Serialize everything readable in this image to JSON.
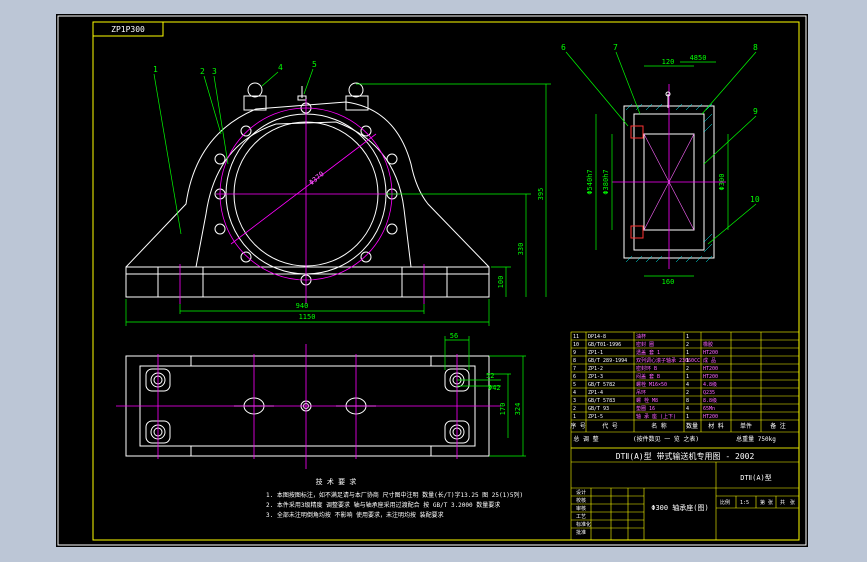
{
  "drawing": {
    "code_box": "ZP1P300",
    "colors": {
      "background": "#000000",
      "outline": "#ffffff",
      "frame": "#ffff00",
      "dimension": "#00ff00",
      "centerline": "#ff00ff",
      "hatch": "#00ffff",
      "text_magenta": "#ff66ff",
      "hidden": "#ff3333"
    }
  },
  "front_view": {
    "balloons": [
      "1",
      "2",
      "3",
      "4",
      "5"
    ],
    "dims": {
      "bore": "Φ370",
      "height_total": "395",
      "center_height": "330",
      "base_height": "100",
      "hole_span": "940",
      "overall_length": "1150"
    }
  },
  "section_view": {
    "balloons": [
      "6",
      "7",
      "8",
      "9",
      "10"
    ],
    "dims": {
      "top_a": "120",
      "top_b": "4850",
      "outer_d": "Φ540h7",
      "inner_d": "Φ380h7",
      "bore_d": "Φ300",
      "bottom": "160"
    }
  },
  "top_view": {
    "dims": {
      "slot": "56",
      "slot_b": "52",
      "hole": "Φ42",
      "width_a": "170",
      "width_b": "324"
    }
  },
  "notes": {
    "heading": "技 术 要 求",
    "lines": [
      "1. 本图按图标注，如不满足请与本厂协商 尺寸图中注明 数量(长/T)字13.25 图 25(1)5列)",
      "2. 本件采用3级精度 调整要求 轴与轴承座采用过渡配合 按 GB/T 3.2000 数量要求",
      "3. 全部未注明倒角均按 不影响 使用要求，未注明均按 装配要求"
    ]
  },
  "parts_table": {
    "rows": [
      [
        "11",
        "DP14-8",
        "油杯",
        "1",
        "",
        "",
        ""
      ],
      [
        "10",
        "GB/T01-1996",
        "密封 圈",
        "2",
        "橡胶",
        "",
        ""
      ],
      [
        "9",
        "ZP1-1",
        "透盖 套 1",
        "1",
        "HT200",
        "",
        ""
      ],
      [
        "8",
        "GB/T 289-1994",
        "双列调心滚子轴承 23060CC",
        "1",
        "成 品",
        "",
        ""
      ],
      [
        "7",
        "ZP1-2",
        "密封环 B",
        "2",
        "HT200",
        "",
        ""
      ],
      [
        "6",
        "ZP1-3",
        "闷盖 套 B",
        "1",
        "HT200",
        "",
        ""
      ],
      [
        "5",
        "GB/T 5782",
        "螺栓 M16×50",
        "4",
        "4.8级",
        "",
        ""
      ],
      [
        "4",
        "ZP1-4",
        "吊环",
        "2",
        "Q235",
        "",
        ""
      ],
      [
        "3",
        "GB/T 5783",
        "螺 栓 M8",
        "8",
        "8.8级",
        "",
        ""
      ],
      [
        "2",
        "GB/T 93",
        "垫圈 16",
        "4",
        "65Mn",
        "",
        ""
      ],
      [
        "1",
        "ZP1-5",
        "轴 承 座 (上下)",
        "1",
        "HT200",
        "",
        ""
      ]
    ],
    "header": [
      "序 号",
      "代 号",
      "名 称",
      "数量",
      "材 料",
      "单件",
      "备 注"
    ],
    "under_header": [
      "总 调 整",
      "(按件数见 一 览 之表)",
      "总重量 750kg"
    ]
  },
  "title_block": {
    "series": "DTⅡ(A)型 带式输送机专用图 - 2002",
    "code": "DTⅡ(A)型",
    "drawing_name": "Φ300 轴承座(图)",
    "small_labels": [
      "设计",
      "校核",
      "审核",
      "工艺",
      "标准化",
      "批准",
      "比例",
      "1:5",
      "第",
      "张",
      "共",
      "张"
    ]
  }
}
